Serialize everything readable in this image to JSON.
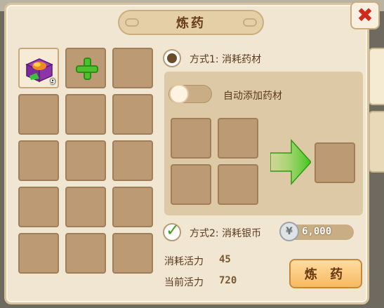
{
  "window": {
    "title": "炼药"
  },
  "close_button": {
    "label": "✖",
    "icon": "close-icon"
  },
  "inventory": {
    "slots": [
      {
        "item": "chest",
        "qty": "9"
      },
      {
        "item": "add"
      },
      {},
      {},
      {},
      {},
      {},
      {},
      {},
      {},
      {},
      {},
      {},
      {},
      {}
    ]
  },
  "mode1": {
    "label": "方式1: 消耗药材",
    "selected": true
  },
  "auto_add": {
    "label": "自动添加药材",
    "on": false
  },
  "mode2": {
    "label": "方式2: 消耗银币",
    "checked": true,
    "cost": "6,000",
    "coin_icon": "silver-coin-icon"
  },
  "stats": {
    "consume_label": "消耗活力",
    "consume_value": "45",
    "current_label": "当前活力",
    "current_value": "720"
  },
  "refine_button": {
    "label": "炼 药"
  },
  "colors": {
    "accent_green": "#4cc12c",
    "close_red": "#d02a1c",
    "button_orange": "#f7b960"
  }
}
